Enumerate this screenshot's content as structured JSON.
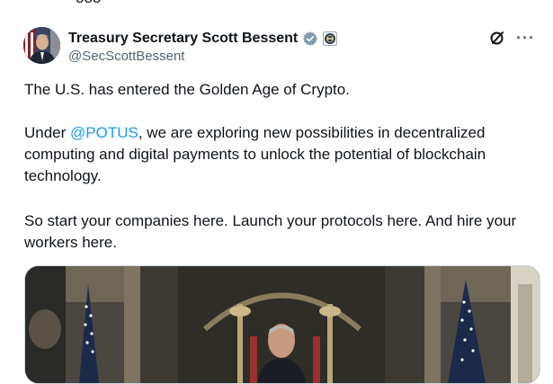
{
  "top_partial_text": "ooo",
  "tweet": {
    "author": {
      "display_name": "Treasury Secretary Scott Bessent",
      "handle": "@SecScottBessent",
      "verified_badge": "gray-verified-badge-icon",
      "affiliation_badge": "treasury-seal-icon"
    },
    "actions": {
      "grok_icon": "grok-icon",
      "more_icon": "more-icon",
      "more_label": "···"
    },
    "text": {
      "line1": "The U.S. has entered the Golden Age of Crypto.",
      "para2_prefix": "Under ",
      "para2_mention": "@POTUS",
      "para2_line1_rest": ", we are exploring new possibilities in decentralized",
      "para2_line2": "computing and digital payments to unlock the potential of blockchain",
      "para2_line3": "technology.",
      "para3_line1": "So start your companies here. Launch your protocols here. And hire your",
      "para3_line2": "workers here."
    },
    "media": {
      "type": "photo"
    }
  },
  "colors": {
    "text": "#0f1419",
    "secondary": "#536471",
    "link": "#1d9bf0",
    "badge_gray": "#829aab"
  }
}
